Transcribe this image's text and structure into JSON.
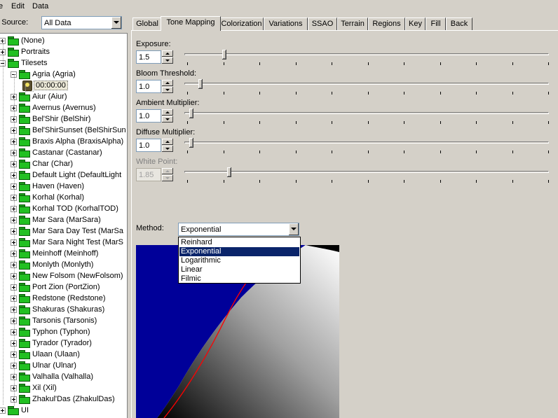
{
  "menu": {
    "items": [
      "e",
      "Edit",
      "Data"
    ]
  },
  "data_source": {
    "label": "ta Source:",
    "value": "All Data"
  },
  "tree": {
    "root_items": [
      {
        "label": "(None)"
      },
      {
        "label": "Portraits"
      },
      {
        "label": "Tilesets"
      }
    ],
    "expanded": {
      "label": "Agria (Agria)",
      "child": "00:00:00"
    },
    "tilesets": [
      "Aiur (Aiur)",
      "Avernus (Avernus)",
      "Bel'Shir (BelShir)",
      "Bel'ShirSunset (BelShirSun",
      "Braxis Alpha (BraxisAlpha)",
      "Castanar (Castanar)",
      "Char (Char)",
      "Default Light (DefaultLight",
      "Haven (Haven)",
      "Korhal (Korhal)",
      "Korhal TOD (KorhalTOD)",
      "Mar Sara (MarSara)",
      "Mar Sara Day Test (MarSa",
      "Mar Sara Night Test (MarS",
      "Meinhoff (Meinhoff)",
      "Monlyth (Monlyth)",
      "New Folsom (NewFolsom)",
      "Port Zion (PortZion)",
      "Redstone (Redstone)",
      "Shakuras (Shakuras)",
      "Tarsonis (Tarsonis)",
      "Typhon (Typhon)",
      "Tyrador (Tyrador)",
      "Ulaan (Ulaan)",
      "Ulnar (Ulnar)",
      "Valhalla (Valhalla)",
      "Xil (Xil)",
      "Zhakul'Das (ZhakulDas)"
    ],
    "last": "UI"
  },
  "tabs": [
    "Global",
    "Tone Mapping",
    "Colorization",
    "Variations",
    "SSAO",
    "Terrain",
    "Regions",
    "Key",
    "Fill",
    "Back"
  ],
  "active_tab": "Tone Mapping",
  "params": [
    {
      "label": "Exposure:",
      "value": "1.5",
      "level": 0.1,
      "enabled": true
    },
    {
      "label": "Bloom Threshold:",
      "value": "1.0",
      "level": 0.035,
      "enabled": true
    },
    {
      "label": "Ambient Multiplier:",
      "value": "1.0",
      "level": 0.01,
      "enabled": true
    },
    {
      "label": "Diffuse Multiplier:",
      "value": "1.0",
      "level": 0.01,
      "enabled": true
    },
    {
      "label": "White Point:",
      "value": "1.85",
      "level": 0.115,
      "enabled": false
    }
  ],
  "method": {
    "label": "Method:",
    "value": "Exponential",
    "options": [
      "Reinhard",
      "Exponential",
      "Logarithmic",
      "Linear",
      "Filmic"
    ],
    "highlighted": "Exponential"
  },
  "colors": {
    "graph_bg": "#000099",
    "curve": "#ff0000",
    "selection": "#0a246a"
  }
}
